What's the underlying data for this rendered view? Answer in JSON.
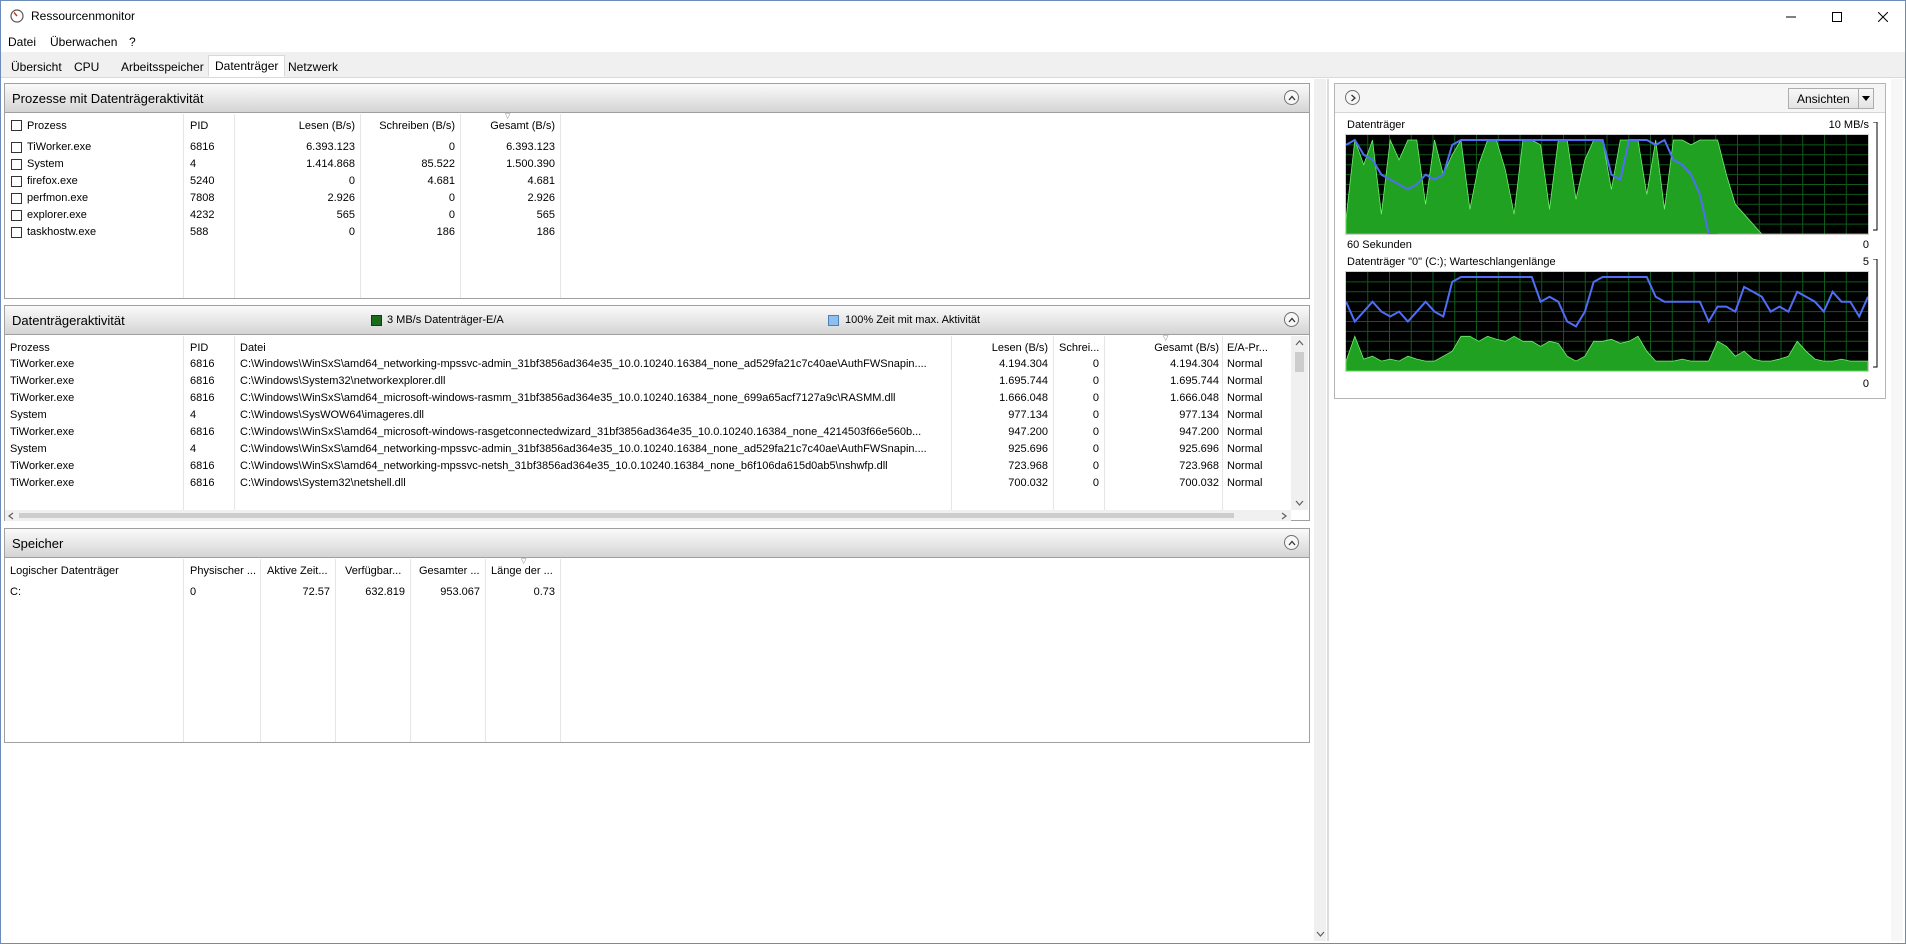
{
  "window": {
    "title": "Ressourcenmonitor"
  },
  "menu": {
    "items": [
      "Datei",
      "Überwachen",
      "?"
    ]
  },
  "tabs": [
    "Übersicht",
    "CPU",
    "Arbeitsspeicher",
    "Datenträger",
    "Netzwerk"
  ],
  "active_tab": "Datenträger",
  "processes_panel": {
    "title": "Prozesse mit Datenträgeraktivität",
    "columns": [
      "Prozess",
      "PID",
      "Lesen (B/s)",
      "Schreiben (B/s)",
      "Gesamt (B/s)"
    ],
    "rows": [
      {
        "process": "TiWorker.exe",
        "pid": "6816",
        "read": "6.393.123",
        "write": "0",
        "total": "6.393.123"
      },
      {
        "process": "System",
        "pid": "4",
        "read": "1.414.868",
        "write": "85.522",
        "total": "1.500.390"
      },
      {
        "process": "firefox.exe",
        "pid": "5240",
        "read": "0",
        "write": "4.681",
        "total": "4.681"
      },
      {
        "process": "perfmon.exe",
        "pid": "7808",
        "read": "2.926",
        "write": "0",
        "total": "2.926"
      },
      {
        "process": "explorer.exe",
        "pid": "4232",
        "read": "565",
        "write": "0",
        "total": "565"
      },
      {
        "process": "taskhostw.exe",
        "pid": "588",
        "read": "0",
        "write": "186",
        "total": "186"
      }
    ]
  },
  "activity_panel": {
    "title": "Datenträgeraktivität",
    "legend_io": "3 MB/s Datenträger-E/A",
    "legend_time": "100% Zeit mit max. Aktivität",
    "colors": {
      "io": "#1c7a1c",
      "time": "#8fbfef"
    },
    "columns": [
      "Prozess",
      "PID",
      "Datei",
      "Lesen (B/s)",
      "Schrei...",
      "Gesamt (B/s)",
      "E/A-Pr..."
    ],
    "rows": [
      {
        "process": "TiWorker.exe",
        "pid": "6816",
        "file": "C:\\Windows\\WinSxS\\amd64_networking-mpssvc-admin_31bf3856ad364e35_10.0.10240.16384_none_ad529fa21c7c40ae\\AuthFWSnapin....",
        "read": "4.194.304",
        "write": "0",
        "total": "4.194.304",
        "prio": "Normal"
      },
      {
        "process": "TiWorker.exe",
        "pid": "6816",
        "file": "C:\\Windows\\System32\\networkexplorer.dll",
        "read": "1.695.744",
        "write": "0",
        "total": "1.695.744",
        "prio": "Normal"
      },
      {
        "process": "TiWorker.exe",
        "pid": "6816",
        "file": "C:\\Windows\\WinSxS\\amd64_microsoft-windows-rasmm_31bf3856ad364e35_10.0.10240.16384_none_699a65acf7127a9c\\RASMM.dll",
        "read": "1.666.048",
        "write": "0",
        "total": "1.666.048",
        "prio": "Normal"
      },
      {
        "process": "System",
        "pid": "4",
        "file": "C:\\Windows\\SysWOW64\\imageres.dll",
        "read": "977.134",
        "write": "0",
        "total": "977.134",
        "prio": "Normal"
      },
      {
        "process": "TiWorker.exe",
        "pid": "6816",
        "file": "C:\\Windows\\WinSxS\\amd64_microsoft-windows-rasgetconnectedwizard_31bf3856ad364e35_10.0.10240.16384_none_4214503f66e560b...",
        "read": "947.200",
        "write": "0",
        "total": "947.200",
        "prio": "Normal"
      },
      {
        "process": "System",
        "pid": "4",
        "file": "C:\\Windows\\WinSxS\\amd64_networking-mpssvc-admin_31bf3856ad364e35_10.0.10240.16384_none_ad529fa21c7c40ae\\AuthFWSnapin....",
        "read": "925.696",
        "write": "0",
        "total": "925.696",
        "prio": "Normal"
      },
      {
        "process": "TiWorker.exe",
        "pid": "6816",
        "file": "C:\\Windows\\WinSxS\\amd64_networking-mpssvc-netsh_31bf3856ad364e35_10.0.10240.16384_none_b6f106da615d0ab5\\nshwfp.dll",
        "read": "723.968",
        "write": "0",
        "total": "723.968",
        "prio": "Normal"
      },
      {
        "process": "TiWorker.exe",
        "pid": "6816",
        "file": "C:\\Windows\\System32\\netshell.dll",
        "read": "700.032",
        "write": "0",
        "total": "700.032",
        "prio": "Normal"
      }
    ]
  },
  "storage_panel": {
    "title": "Speicher",
    "columns": [
      "Logischer Datenträger",
      "Physischer ...",
      "Aktive Zeit...",
      "Verfügbar...",
      "Gesamter ...",
      "Länge der ..."
    ],
    "rows": [
      {
        "logical": "C:",
        "physical": "0",
        "active": "72.57",
        "available": "632.819",
        "total": "953.067",
        "queue": "0.73"
      }
    ]
  },
  "right_panel": {
    "views_button": "Ansichten",
    "graph1": {
      "title": "Datenträger",
      "max_label": "10 MB/s",
      "time_label": "60 Sekunden",
      "min_label": "0",
      "io_values": [
        0.15,
        0.95,
        0.7,
        0.95,
        0.2,
        0.95,
        0.75,
        0.95,
        0.95,
        0.3,
        0.95,
        0.6,
        0.8,
        0.95,
        0.25,
        0.7,
        0.95,
        0.95,
        0.65,
        0.2,
        0.95,
        0.95,
        0.9,
        0.25,
        0.95,
        0.95,
        0.35,
        0.75,
        0.95,
        0.95,
        0.45,
        0.95,
        0.95,
        0.95,
        0.4,
        0.95,
        0.25,
        0.95,
        0.95,
        0.9,
        0.95,
        0.95,
        0.95,
        0.6,
        0.3,
        0.2,
        0.1,
        0.0,
        0.0,
        0.0,
        0.0,
        0.0,
        0.0,
        0.0,
        0.0,
        0.0,
        0.0,
        0.0,
        0.0,
        0.0
      ],
      "time_values": [
        0.9,
        0.95,
        0.8,
        0.75,
        0.6,
        0.55,
        0.5,
        0.45,
        0.5,
        0.6,
        0.55,
        0.6,
        0.9,
        0.95,
        0.95,
        0.95,
        0.95,
        0.95,
        0.95,
        0.95,
        0.95,
        0.95,
        0.95,
        0.95,
        0.95,
        0.95,
        0.95,
        0.95,
        0.95,
        0.95,
        0.6,
        0.55,
        0.95,
        0.95,
        0.95,
        0.9,
        0.95,
        0.75,
        0.7,
        0.6,
        0.4,
        0.0,
        0.0,
        null,
        null,
        null,
        null,
        null,
        null,
        null,
        null,
        null,
        null,
        null,
        null,
        null,
        null,
        null,
        null,
        null
      ]
    },
    "graph2": {
      "title": "Datenträger \"0\" (C:); Warteschlangenlänge",
      "max_label": "5",
      "min_label": "0",
      "queue_values": [
        0.1,
        0.35,
        0.12,
        0.15,
        0.1,
        0.12,
        0.1,
        0.15,
        0.12,
        0.1,
        0.1,
        0.15,
        0.2,
        0.35,
        0.35,
        0.3,
        0.35,
        0.32,
        0.3,
        0.35,
        0.3,
        0.3,
        0.25,
        0.3,
        0.28,
        0.15,
        0.1,
        0.15,
        0.3,
        0.3,
        0.32,
        0.28,
        0.3,
        0.35,
        0.2,
        0.1,
        0.1,
        0.1,
        0.12,
        0.1,
        0.1,
        0.1,
        0.3,
        0.25,
        0.15,
        0.2,
        0.12,
        0.1,
        0.1,
        0.12,
        0.15,
        0.3,
        0.2,
        0.12,
        0.1,
        0.1,
        0.12,
        0.1,
        0.1,
        0.1
      ],
      "time_values": [
        0.7,
        0.5,
        0.6,
        0.7,
        0.6,
        0.55,
        0.6,
        0.5,
        0.6,
        0.7,
        0.6,
        0.55,
        0.9,
        0.95,
        0.95,
        0.95,
        0.95,
        0.95,
        0.95,
        0.95,
        0.95,
        0.95,
        0.7,
        0.75,
        0.7,
        0.5,
        0.45,
        0.6,
        0.9,
        0.95,
        0.95,
        0.95,
        0.95,
        0.95,
        0.95,
        0.75,
        0.7,
        0.7,
        0.7,
        0.7,
        0.7,
        0.5,
        0.65,
        0.65,
        0.6,
        0.85,
        0.8,
        0.75,
        0.6,
        0.65,
        0.6,
        0.8,
        0.75,
        0.7,
        0.6,
        0.8,
        0.7,
        0.7,
        0.55,
        0.75
      ]
    }
  }
}
